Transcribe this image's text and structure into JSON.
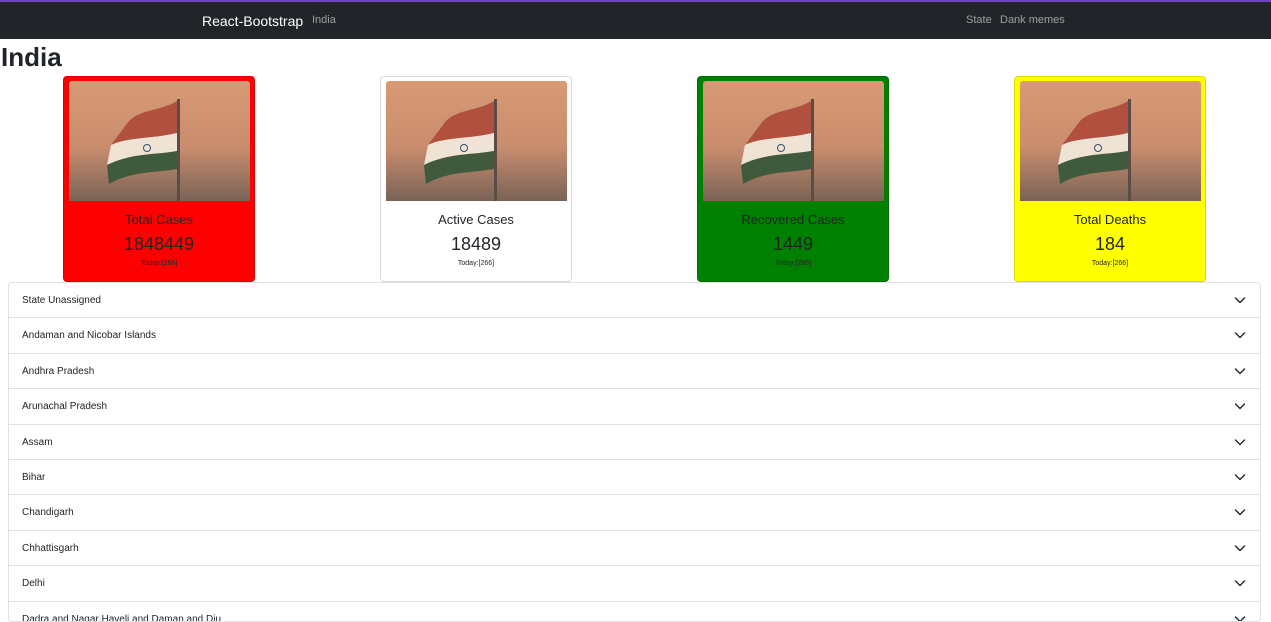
{
  "navbar": {
    "brand": "React-Bootstrap",
    "links": [
      "India",
      "State",
      "Dank memes"
    ]
  },
  "page_title": "India",
  "cards": [
    {
      "title": "Total Cases",
      "count": "1848449",
      "today": "Today:[266]",
      "bg": "#ff0000"
    },
    {
      "title": "Active Cases",
      "count": "18489",
      "today": "Today:[266]",
      "bg": "#ffffff"
    },
    {
      "title": "Recovered Cases",
      "count": "1449",
      "today": "Today:[266]",
      "bg": "#008000"
    },
    {
      "title": "Total Deaths",
      "count": "184",
      "today": "Today:[266]",
      "bg": "#ffff00"
    }
  ],
  "states": [
    "State Unassigned",
    "Andaman and Nicobar Islands",
    "Andhra Pradesh",
    "Arunachal Pradesh",
    "Assam",
    "Bihar",
    "Chandigarh",
    "Chhattisgarh",
    "Delhi",
    "Dadra and Nagar Haveli and Daman and Diu"
  ],
  "icons": {
    "accordion_toggle": "chevron-down-icon",
    "card_image": "india-flag-image"
  }
}
